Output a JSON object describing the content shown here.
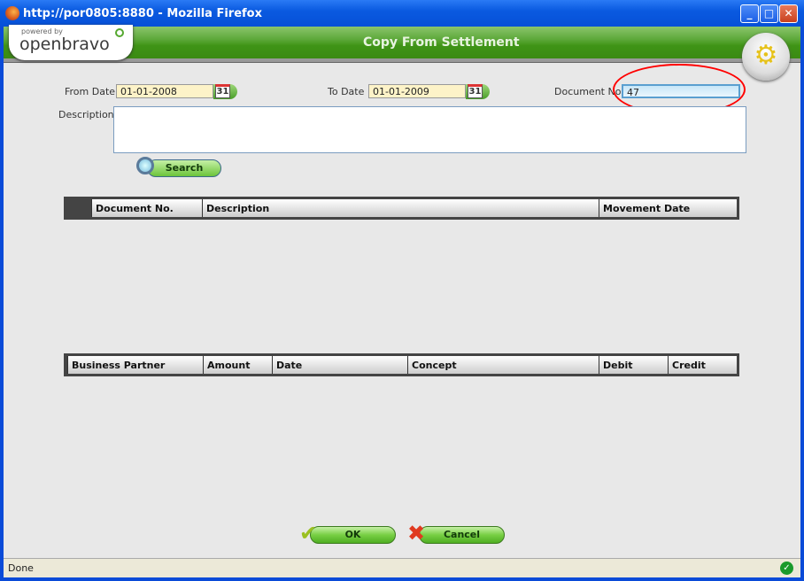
{
  "window": {
    "title": "http://por0805:8880 - Mozilla Firefox"
  },
  "header": {
    "logo_small": "powered by",
    "logo": "openbravo",
    "title": "Copy From Settlement"
  },
  "form": {
    "from_date_label": "From Date",
    "from_date": "01-01-2008",
    "to_date_label": "To Date",
    "to_date": "01-01-2009",
    "document_no_label": "Document No.",
    "document_no": "47",
    "description_label": "Description:",
    "description": "",
    "calendar_day": "31",
    "search_label": "Search"
  },
  "table1": {
    "columns": [
      "Document No.",
      "Description",
      "Movement Date"
    ]
  },
  "table2": {
    "columns": [
      "Business Partner",
      "Amount",
      "Date",
      "Concept",
      "Debit",
      "Credit"
    ]
  },
  "buttons": {
    "ok": "OK",
    "cancel": "Cancel"
  },
  "status": {
    "text": "Done"
  },
  "colors": {
    "highlight": "#ff0000",
    "accent": "#3f9416"
  }
}
